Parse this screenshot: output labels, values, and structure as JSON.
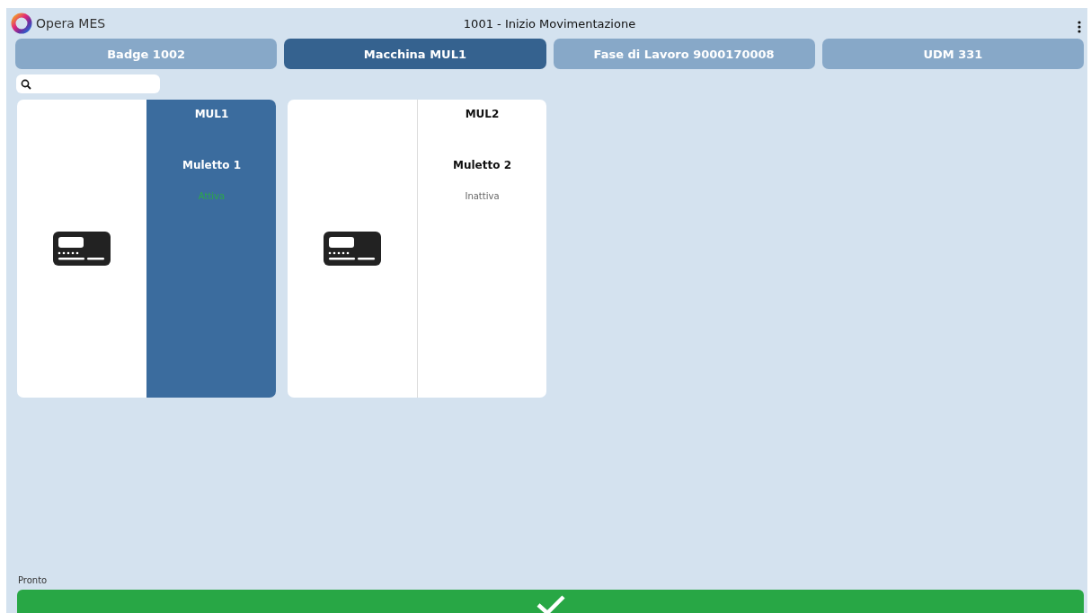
{
  "app": {
    "name": "Opera MES",
    "title": "1001 - Inizio Movimentazione"
  },
  "tabs": [
    {
      "label": "Badge 1002",
      "selected": false
    },
    {
      "label": "Macchina MUL1",
      "selected": true
    },
    {
      "label": "Fase di Lavoro 9000170008",
      "selected": false
    },
    {
      "label": "UDM 331",
      "selected": false
    }
  ],
  "cards": [
    {
      "code": "MUL1",
      "name": "Muletto 1",
      "status": "Attiva",
      "active": true,
      "selected": true
    },
    {
      "code": "MUL2",
      "name": "Muletto 2",
      "status": "Inattiva",
      "active": false,
      "selected": false
    }
  ],
  "status_bar": {
    "text": "Pronto"
  }
}
